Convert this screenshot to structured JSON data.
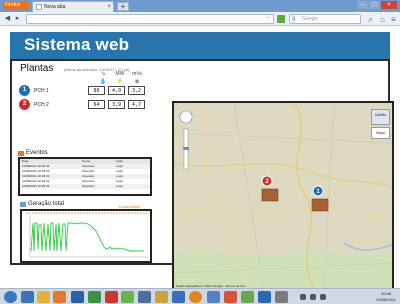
{
  "browser": {
    "menu_button": "Firefox",
    "tab_title": "Nova aba",
    "search_placeholder": "Google"
  },
  "page": {
    "title": "Sistema web",
    "plantas": {
      "title": "Plantas",
      "subtitle": "[última atualização: 10/08/11 - 20:48]",
      "columns": [
        {
          "label": "MW",
          "icon": "power-icon"
        },
        {
          "label": "m³/s",
          "icon": "flow-icon"
        },
        {
          "label": "",
          "icon": "level-icon"
        }
      ],
      "rows": [
        {
          "id": "1",
          "name": "PCH 1",
          "values": [
            "80",
            "4,9",
            "3,2"
          ],
          "color": "#1f6db3"
        },
        {
          "id": "2",
          "name": "PCH 2",
          "values": [
            "64",
            "3,9",
            "4,7"
          ],
          "color": "#c8302b"
        }
      ]
    },
    "eventos": {
      "title": "Eventos",
      "headers": [
        "Data",
        "Nome",
        "Ação"
      ],
      "rows": [
        [
          "10/08/2011 20:28:33",
          "Operador",
          "Login"
        ],
        [
          "10/08/2011 20:28:33",
          "Operador",
          "Login"
        ],
        [
          "10/08/2011 20:28:33",
          "Operador",
          "Login"
        ],
        [
          "10/08/2011 20:28:33",
          "Operador",
          "Login"
        ],
        [
          "10/08/2011 20:28:33",
          "Operador",
          "Login"
        ]
      ]
    },
    "geracao": {
      "title": "Geração total",
      "capacidade_label": "Capacidade"
    },
    "map": {
      "buttons": [
        "Satélite",
        "Mapa"
      ],
      "markers": [
        {
          "id": "1",
          "color": "#1f6db3"
        },
        {
          "id": "2",
          "color": "#c8302b"
        }
      ],
      "footer": "Dados cartográficos ©2011 Google - Termos de Uso"
    }
  },
  "taskbar": {
    "clock_time": "20:48",
    "clock_date": "10/08/2011"
  },
  "colors": {
    "header_bg": "#2874ad",
    "pch1": "#1f6db3",
    "pch2": "#c8302b",
    "capacity": "#e67e22",
    "generation_line": "#2ecc40"
  }
}
